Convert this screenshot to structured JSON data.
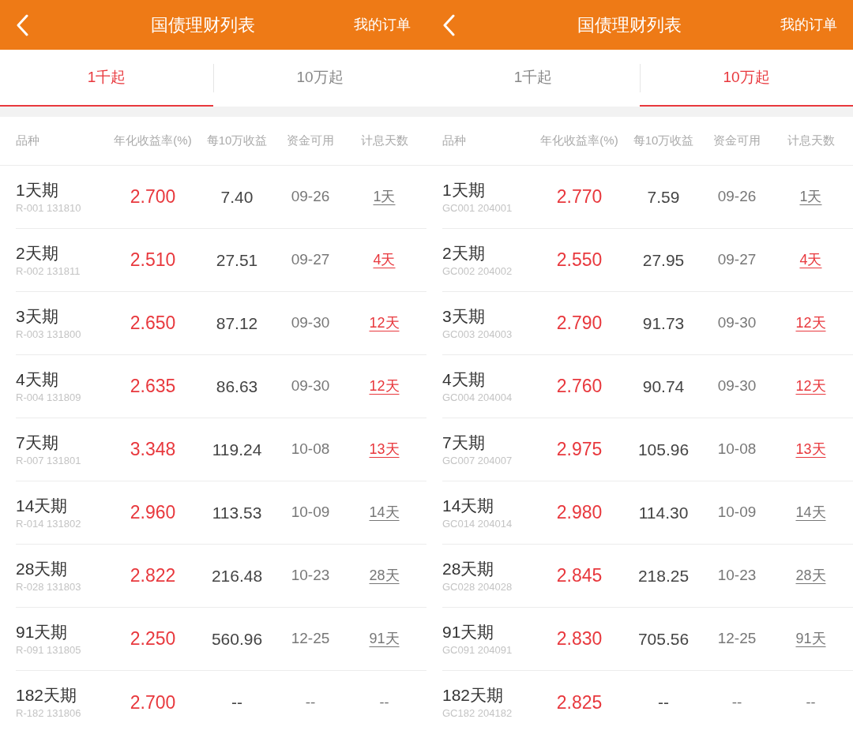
{
  "panels": [
    {
      "title": "国债理财列表",
      "action": "我的订单",
      "tabs": [
        {
          "label": "1千起",
          "selected": true
        },
        {
          "label": "10万起",
          "selected": false
        }
      ],
      "columns": [
        "品种",
        "年化收益率(%)",
        "每10万收益",
        "资金可用",
        "计息天数"
      ],
      "rows": [
        {
          "name": "1天期",
          "code": "R-001 131810",
          "rate": "2.700",
          "income": "7.40",
          "date": "09-26",
          "days": "1天",
          "days_highlight": false,
          "kind": "link"
        },
        {
          "name": "2天期",
          "code": "R-002 131811",
          "rate": "2.510",
          "income": "27.51",
          "date": "09-27",
          "days": "4天",
          "days_highlight": true,
          "kind": "link"
        },
        {
          "name": "3天期",
          "code": "R-003 131800",
          "rate": "2.650",
          "income": "87.12",
          "date": "09-30",
          "days": "12天",
          "days_highlight": true,
          "kind": "link"
        },
        {
          "name": "4天期",
          "code": "R-004 131809",
          "rate": "2.635",
          "income": "86.63",
          "date": "09-30",
          "days": "12天",
          "days_highlight": true,
          "kind": "link"
        },
        {
          "name": "7天期",
          "code": "R-007 131801",
          "rate": "3.348",
          "income": "119.24",
          "date": "10-08",
          "days": "13天",
          "days_highlight": true,
          "kind": "link"
        },
        {
          "name": "14天期",
          "code": "R-014 131802",
          "rate": "2.960",
          "income": "113.53",
          "date": "10-09",
          "days": "14天",
          "days_highlight": false,
          "kind": "link"
        },
        {
          "name": "28天期",
          "code": "R-028 131803",
          "rate": "2.822",
          "income": "216.48",
          "date": "10-23",
          "days": "28天",
          "days_highlight": false,
          "kind": "link"
        },
        {
          "name": "91天期",
          "code": "R-091 131805",
          "rate": "2.250",
          "income": "560.96",
          "date": "12-25",
          "days": "91天",
          "days_highlight": false,
          "kind": "link"
        },
        {
          "name": "182天期",
          "code": "R-182 131806",
          "rate": "2.700",
          "income": "--",
          "date": "--",
          "days": "--",
          "days_highlight": false,
          "kind": "plain"
        }
      ]
    },
    {
      "title": "国债理财列表",
      "action": "我的订单",
      "tabs": [
        {
          "label": "1千起",
          "selected": false
        },
        {
          "label": "10万起",
          "selected": true
        }
      ],
      "columns": [
        "品种",
        "年化收益率(%)",
        "每10万收益",
        "资金可用",
        "计息天数"
      ],
      "rows": [
        {
          "name": "1天期",
          "code": "GC001 204001",
          "rate": "2.770",
          "income": "7.59",
          "date": "09-26",
          "days": "1天",
          "days_highlight": false,
          "kind": "link"
        },
        {
          "name": "2天期",
          "code": "GC002 204002",
          "rate": "2.550",
          "income": "27.95",
          "date": "09-27",
          "days": "4天",
          "days_highlight": true,
          "kind": "link"
        },
        {
          "name": "3天期",
          "code": "GC003 204003",
          "rate": "2.790",
          "income": "91.73",
          "date": "09-30",
          "days": "12天",
          "days_highlight": true,
          "kind": "link"
        },
        {
          "name": "4天期",
          "code": "GC004 204004",
          "rate": "2.760",
          "income": "90.74",
          "date": "09-30",
          "days": "12天",
          "days_highlight": true,
          "kind": "link"
        },
        {
          "name": "7天期",
          "code": "GC007 204007",
          "rate": "2.975",
          "income": "105.96",
          "date": "10-08",
          "days": "13天",
          "days_highlight": true,
          "kind": "link"
        },
        {
          "name": "14天期",
          "code": "GC014 204014",
          "rate": "2.980",
          "income": "114.30",
          "date": "10-09",
          "days": "14天",
          "days_highlight": false,
          "kind": "link"
        },
        {
          "name": "28天期",
          "code": "GC028 204028",
          "rate": "2.845",
          "income": "218.25",
          "date": "10-23",
          "days": "28天",
          "days_highlight": false,
          "kind": "link"
        },
        {
          "name": "91天期",
          "code": "GC091 204091",
          "rate": "2.830",
          "income": "705.56",
          "date": "12-25",
          "days": "91天",
          "days_highlight": false,
          "kind": "link"
        },
        {
          "name": "182天期",
          "code": "GC182 204182",
          "rate": "2.825",
          "income": "--",
          "date": "--",
          "days": "--",
          "days_highlight": false,
          "kind": "plain"
        }
      ]
    }
  ]
}
